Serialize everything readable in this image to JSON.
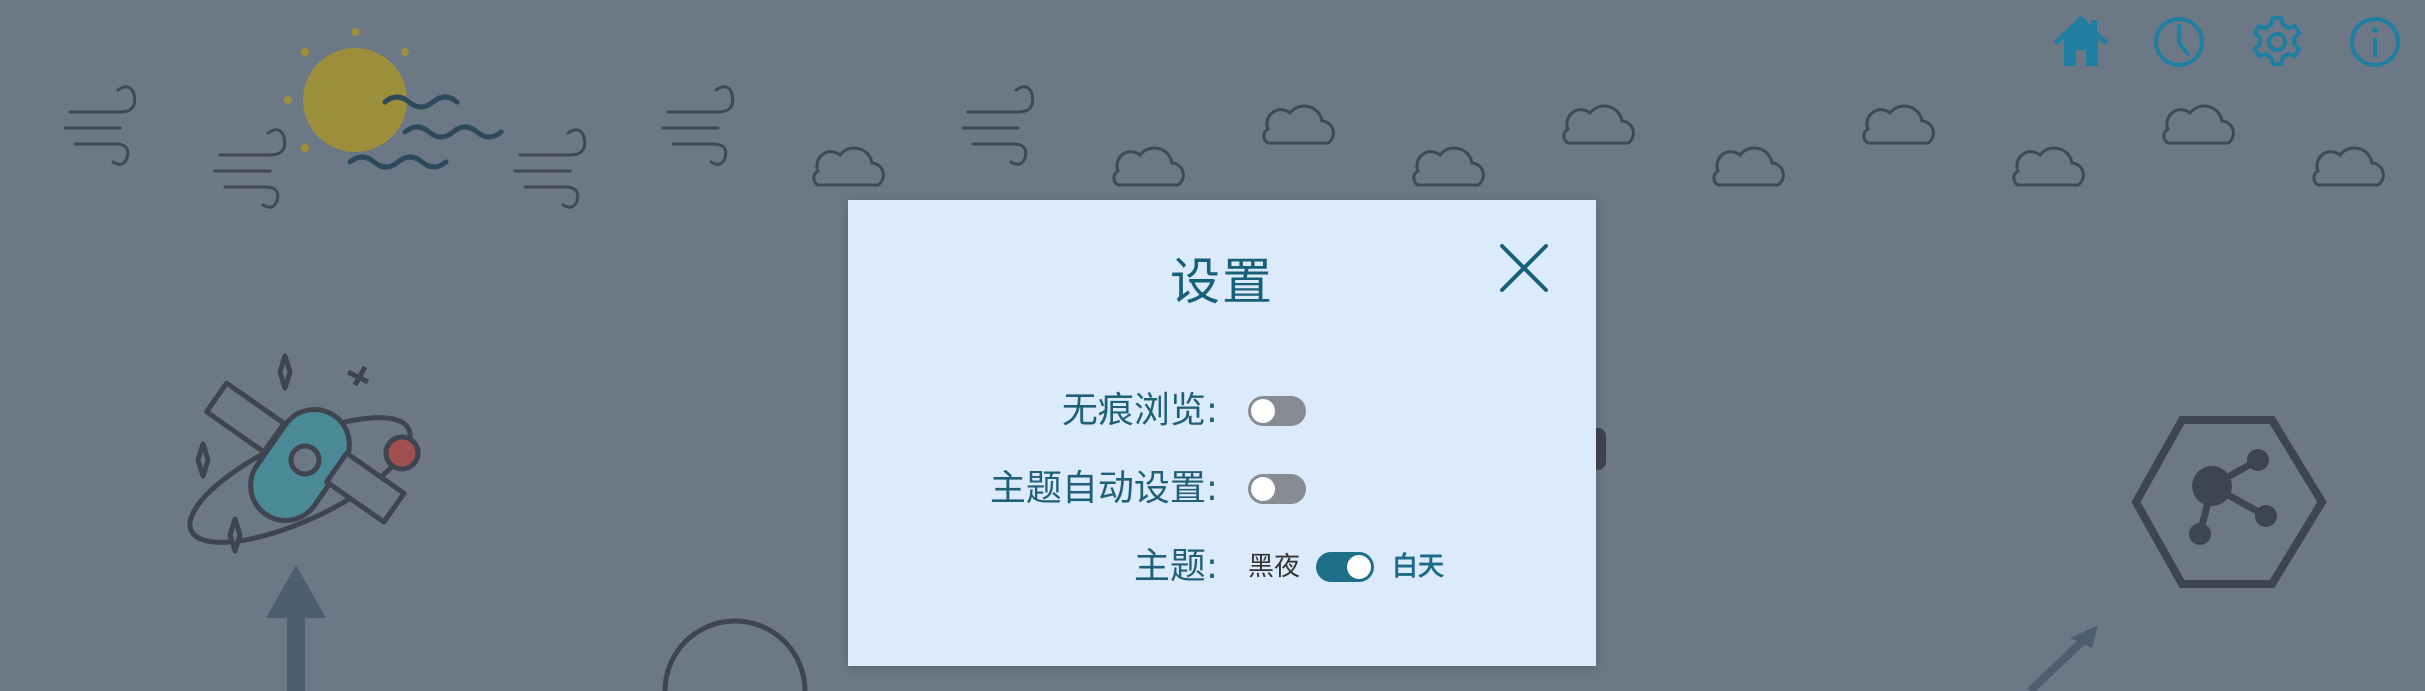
{
  "nav": {
    "home_icon": "home-icon",
    "history_icon": "clock-icon",
    "settings_icon": "gear-icon",
    "about_icon": "info-icon",
    "accent_color": "#1f7fa3"
  },
  "settings_dialog": {
    "title": "设置",
    "close_icon": "close-icon",
    "private_browsing": {
      "label": "无痕浏览:",
      "enabled": false
    },
    "auto_theme": {
      "label": "主题自动设置:",
      "enabled": false
    },
    "theme": {
      "label": "主题:",
      "off_label": "黑夜",
      "on_label": "白天",
      "selected": "白天"
    }
  },
  "colors": {
    "background": "#6c7885",
    "dialog_background": "#dcebfb",
    "primary_text": "#17607a",
    "toggle_off": "#878c92",
    "toggle_on": "#1d6e89"
  }
}
